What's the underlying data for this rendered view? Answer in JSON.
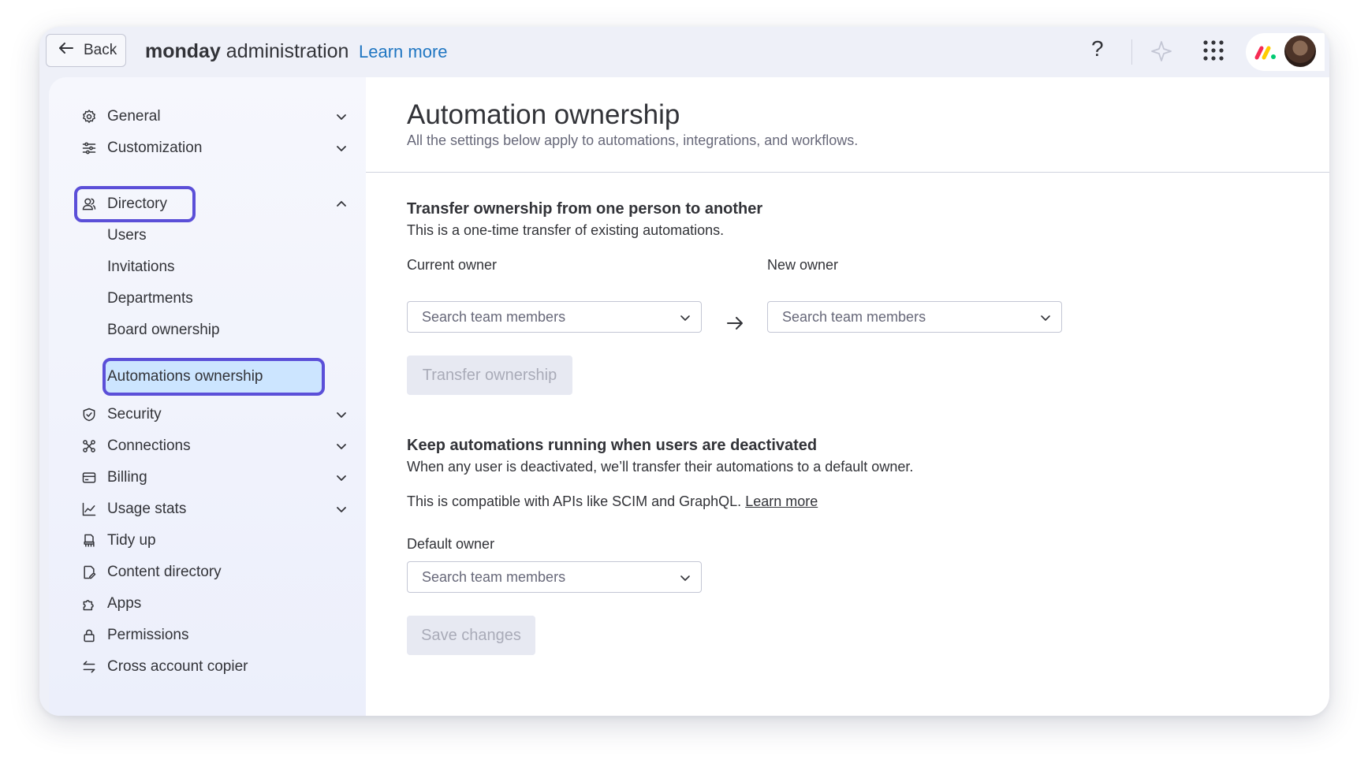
{
  "topbar": {
    "back_label": "Back",
    "brand_bold": "monday",
    "brand_rest": " administration",
    "learn_more": "Learn more",
    "help_symbol": "?"
  },
  "sidebar": {
    "items": [
      {
        "label": "General",
        "icon": "gear-icon",
        "chevron": "down"
      },
      {
        "label": "Customization",
        "icon": "sliders-icon",
        "chevron": "down"
      },
      {
        "label": "Directory",
        "icon": "people-icon",
        "chevron": "up"
      },
      {
        "label": "Security",
        "icon": "shield-icon",
        "chevron": "down"
      },
      {
        "label": "Connections",
        "icon": "connections-icon",
        "chevron": "down"
      },
      {
        "label": "Billing",
        "icon": "card-icon",
        "chevron": "down"
      },
      {
        "label": "Usage stats",
        "icon": "chart-icon",
        "chevron": "down"
      },
      {
        "label": "Tidy up",
        "icon": "broom-icon"
      },
      {
        "label": "Content directory",
        "icon": "content-icon"
      },
      {
        "label": "Apps",
        "icon": "puzzle-icon"
      },
      {
        "label": "Permissions",
        "icon": "lock-icon"
      },
      {
        "label": "Cross account copier",
        "icon": "swap-icon"
      }
    ],
    "directory_sub": [
      "Users",
      "Invitations",
      "Departments",
      "Board ownership",
      "Automations ownership"
    ],
    "selected": "Automations ownership"
  },
  "main": {
    "title": "Automation ownership",
    "subtitle": "All the settings below apply to automations, integrations, and workflows.",
    "transfer": {
      "title": "Transfer ownership from one person to another",
      "text": "This is a one-time transfer of existing automations.",
      "current_owner_label": "Current owner",
      "new_owner_label": "New owner",
      "current_placeholder": "Search team members",
      "new_placeholder": "Search team members",
      "button": "Transfer ownership"
    },
    "deactivated": {
      "title": "Keep automations running when users are deactivated",
      "text": "When any user is deactivated, we’ll transfer their automations to a default owner.",
      "compat_text": "This is compatible with APIs like SCIM and GraphQL.",
      "learn_more": "Learn more",
      "default_owner_label": "Default owner",
      "default_placeholder": "Search team members",
      "button": "Save changes"
    }
  },
  "colors": {
    "accent_highlight": "#5b4fd8",
    "selected_bg": "#cce5ff",
    "link": "#1f76c2"
  }
}
